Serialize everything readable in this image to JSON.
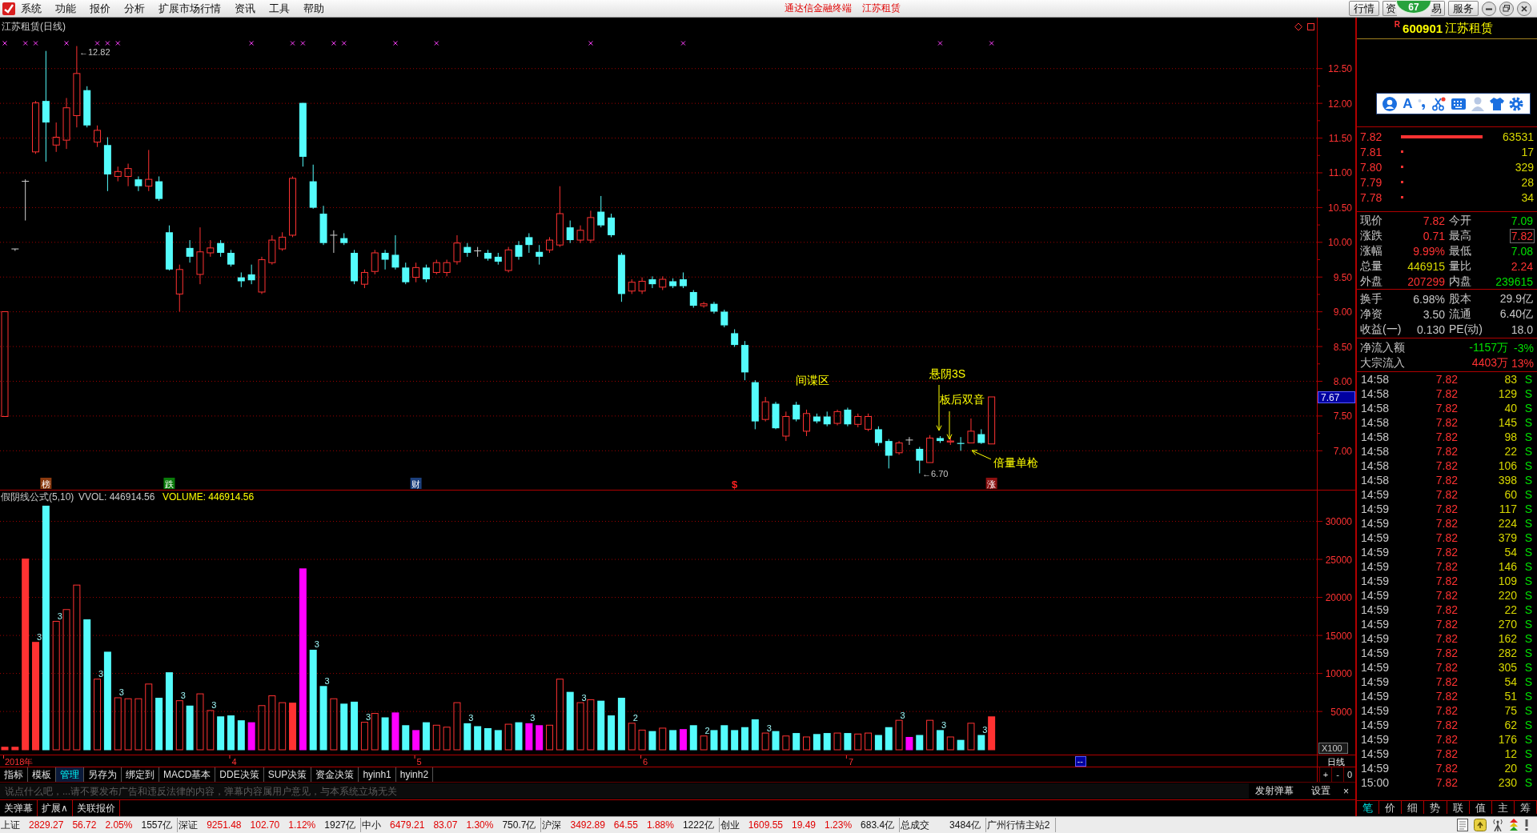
{
  "menu_bar": {
    "items": [
      "系统",
      "功能",
      "报价",
      "分析",
      "扩展市场行情",
      "资讯",
      "工具",
      "帮助"
    ],
    "app_title": "通达信金融终端",
    "stock_name": "江苏租赁",
    "buttons": [
      "行情",
      "资",
      "易",
      "服务"
    ],
    "badge": "67"
  },
  "price_chart": {
    "title": "江苏租赁(日线)",
    "y_labels": [
      "12.50",
      "12.00",
      "11.50",
      "11.00",
      "10.50",
      "10.00",
      "9.50",
      "9.00",
      "8.50",
      "8.00",
      "7.50",
      "7.00"
    ],
    "cursor_price": "7.67",
    "high_label": "←12.82",
    "low_label": "←6.70",
    "annotations": [
      {
        "text": "间谍区",
        "kind": "label"
      },
      {
        "text": "悬阴3S",
        "kind": "pointer"
      },
      {
        "text": "板后双音",
        "kind": "pointer"
      },
      {
        "text": "倍量单枪",
        "kind": "pointer"
      }
    ],
    "event_tags": [
      {
        "text": "榜",
        "kind": "tile",
        "color": "#8b3a0f"
      },
      {
        "text": "跌",
        "kind": "tile",
        "color": "#0a7a0a"
      },
      {
        "text": "财",
        "kind": "tile",
        "color": "#1c3f7c"
      },
      {
        "text": "$",
        "kind": "plain",
        "color": "#ff2020"
      },
      {
        "text": "涨",
        "kind": "tile",
        "color": "#8b1010"
      }
    ]
  },
  "volume_chart": {
    "formula": "假阴线公式(5,10)",
    "vvol": "VVOL: 446914.56",
    "volume": "VOLUME: 446914.56",
    "y_labels": [
      "30000",
      "25000",
      "20000",
      "15000",
      "10000",
      "5000"
    ],
    "unit": "X100",
    "bar_marks": [
      "3",
      "3",
      "3",
      "3",
      "3",
      "3",
      "3",
      "3",
      "3",
      "3",
      "3",
      "3",
      "2",
      "2",
      "3",
      "3",
      "3",
      "3"
    ]
  },
  "date_axis": {
    "labels": [
      "2018年",
      "4",
      "5",
      "6",
      "7"
    ],
    "cursor": "--",
    "period": "日线"
  },
  "toolbar": {
    "tabs": [
      {
        "label": "指标",
        "selected": false
      },
      {
        "label": "模板",
        "selected": false
      },
      {
        "label": "管理",
        "selected": true
      },
      {
        "label": "另存为",
        "selected": false
      },
      {
        "label": "绑定到",
        "selected": false
      },
      {
        "label": "MACD基本",
        "selected": false
      },
      {
        "label": "DDE决策",
        "selected": false
      },
      {
        "label": "SUP决策",
        "selected": false
      },
      {
        "label": "资金决策",
        "selected": false
      },
      {
        "label": "hyinh1",
        "selected": false
      },
      {
        "label": "hyinh2",
        "selected": false
      }
    ],
    "zoom_buttons": [
      "+",
      "-",
      "0"
    ]
  },
  "danmu": {
    "placeholder": "说点什么吧，...请不要发布广告和违反法律的内容，弹幕内容属用户意见，与本系统立场无关",
    "send": "发射弹幕",
    "settings": "设置",
    "close": "×"
  },
  "bottom_buttons": [
    "关弹幕",
    "扩展∧",
    "关联报价"
  ],
  "quote_panel": {
    "market": "R",
    "code": "600901",
    "name": "江苏租赁",
    "ime_mode": "A",
    "order_book": [
      {
        "price": "7.82",
        "volume": "63531",
        "kind": "bar"
      },
      {
        "price": "7.81",
        "volume": "17",
        "kind": "dot"
      },
      {
        "price": "7.80",
        "volume": "329",
        "kind": "dot"
      },
      {
        "price": "7.79",
        "volume": "28",
        "kind": "dot"
      },
      {
        "price": "7.78",
        "volume": "34",
        "kind": "dot"
      }
    ],
    "quote": [
      {
        "label": "现价",
        "value": "7.82",
        "color": "#ff3232",
        "boxed": false
      },
      {
        "label": "今开",
        "value": "7.09",
        "color": "#00e000",
        "boxed": false
      },
      {
        "label": "涨跌",
        "value": "0.71",
        "color": "#ff3232",
        "boxed": false
      },
      {
        "label": "最高",
        "value": "7.82",
        "color": "#ff3232",
        "boxed": true
      },
      {
        "label": "涨幅",
        "value": "9.99%",
        "color": "#ff3232",
        "boxed": false
      },
      {
        "label": "最低",
        "value": "7.08",
        "color": "#00e000",
        "boxed": false
      },
      {
        "label": "总量",
        "value": "446915",
        "color": "#d8d800",
        "boxed": false
      },
      {
        "label": "量比",
        "value": "2.24",
        "color": "#ff3232",
        "boxed": false
      },
      {
        "label": "外盘",
        "value": "207299",
        "color": "#ff3232",
        "boxed": false
      },
      {
        "label": "内盘",
        "value": "239615",
        "color": "#00e000",
        "boxed": false
      }
    ],
    "fundamentals": [
      {
        "label": "换手",
        "value": "6.98%"
      },
      {
        "label": "股本",
        "value": "29.9亿"
      },
      {
        "label": "净资",
        "value": "3.50"
      },
      {
        "label": "流通",
        "value": "6.40亿"
      },
      {
        "label": "收益(一)",
        "value": "0.130"
      },
      {
        "label": "PE(动)",
        "value": "18.0"
      }
    ],
    "fund_flow": [
      {
        "label": "净流入额",
        "value": "-1157万",
        "percent": "-3%",
        "color": "#00e000"
      },
      {
        "label": "大宗流入",
        "value": "4403万",
        "percent": "13%",
        "color": "#ff3232"
      }
    ],
    "ticks": [
      {
        "time": "14:58",
        "price": "7.82",
        "volume": "83",
        "side": "S"
      },
      {
        "time": "14:58",
        "price": "7.82",
        "volume": "129",
        "side": "S"
      },
      {
        "time": "14:58",
        "price": "7.82",
        "volume": "40",
        "side": "S"
      },
      {
        "time": "14:58",
        "price": "7.82",
        "volume": "145",
        "side": "S"
      },
      {
        "time": "14:58",
        "price": "7.82",
        "volume": "98",
        "side": "S"
      },
      {
        "time": "14:58",
        "price": "7.82",
        "volume": "22",
        "side": "S"
      },
      {
        "time": "14:58",
        "price": "7.82",
        "volume": "106",
        "side": "S"
      },
      {
        "time": "14:58",
        "price": "7.82",
        "volume": "398",
        "side": "S"
      },
      {
        "time": "14:59",
        "price": "7.82",
        "volume": "60",
        "side": "S"
      },
      {
        "time": "14:59",
        "price": "7.82",
        "volume": "117",
        "side": "S"
      },
      {
        "time": "14:59",
        "price": "7.82",
        "volume": "224",
        "side": "S"
      },
      {
        "time": "14:59",
        "price": "7.82",
        "volume": "379",
        "side": "S"
      },
      {
        "time": "14:59",
        "price": "7.82",
        "volume": "54",
        "side": "S"
      },
      {
        "time": "14:59",
        "price": "7.82",
        "volume": "146",
        "side": "S"
      },
      {
        "time": "14:59",
        "price": "7.82",
        "volume": "109",
        "side": "S"
      },
      {
        "time": "14:59",
        "price": "7.82",
        "volume": "220",
        "side": "S"
      },
      {
        "time": "14:59",
        "price": "7.82",
        "volume": "22",
        "side": "S"
      },
      {
        "time": "14:59",
        "price": "7.82",
        "volume": "270",
        "side": "S"
      },
      {
        "time": "14:59",
        "price": "7.82",
        "volume": "162",
        "side": "S"
      },
      {
        "time": "14:59",
        "price": "7.82",
        "volume": "282",
        "side": "S"
      },
      {
        "time": "14:59",
        "price": "7.82",
        "volume": "305",
        "side": "S"
      },
      {
        "time": "14:59",
        "price": "7.82",
        "volume": "54",
        "side": "S"
      },
      {
        "time": "14:59",
        "price": "7.82",
        "volume": "51",
        "side": "S"
      },
      {
        "time": "14:59",
        "price": "7.82",
        "volume": "75",
        "side": "S"
      },
      {
        "time": "14:59",
        "price": "7.82",
        "volume": "62",
        "side": "S"
      },
      {
        "time": "14:59",
        "price": "7.82",
        "volume": "176",
        "side": "S"
      },
      {
        "time": "14:59",
        "price": "7.82",
        "volume": "12",
        "side": "S"
      },
      {
        "time": "14:59",
        "price": "7.82",
        "volume": "20",
        "side": "S"
      },
      {
        "time": "15:00",
        "price": "7.82",
        "volume": "230",
        "side": "S"
      }
    ],
    "tabs": [
      {
        "label": "笔",
        "selected": true
      },
      {
        "label": "价",
        "selected": false
      },
      {
        "label": "细",
        "selected": false
      },
      {
        "label": "势",
        "selected": false
      },
      {
        "label": "联",
        "selected": false
      },
      {
        "label": "值",
        "selected": false
      },
      {
        "label": "主",
        "selected": false
      },
      {
        "label": "筹",
        "selected": false
      }
    ]
  },
  "status_bar": {
    "indices": [
      {
        "name": "上证",
        "value": "2829.27",
        "change": "56.72",
        "percent": "2.05%",
        "amount": "1557亿",
        "color": "#e00000"
      },
      {
        "name": "深证",
        "value": "9251.48",
        "change": "102.70",
        "percent": "1.12%",
        "amount": "1927亿",
        "color": "#e00000"
      },
      {
        "name": "中小",
        "value": "6479.21",
        "change": "83.07",
        "percent": "1.30%",
        "amount": "750.7亿",
        "color": "#e00000"
      },
      {
        "name": "沪深",
        "value": "3492.89",
        "change": "64.55",
        "percent": "1.88%",
        "amount": "1222亿",
        "color": "#e00000"
      },
      {
        "name": "创业",
        "value": "1609.55",
        "change": "19.49",
        "percent": "1.23%",
        "amount": "683.4亿",
        "color": "#e00000"
      }
    ],
    "total_label": "总成交",
    "total": "3484亿",
    "server": "广州行情主站2"
  }
}
